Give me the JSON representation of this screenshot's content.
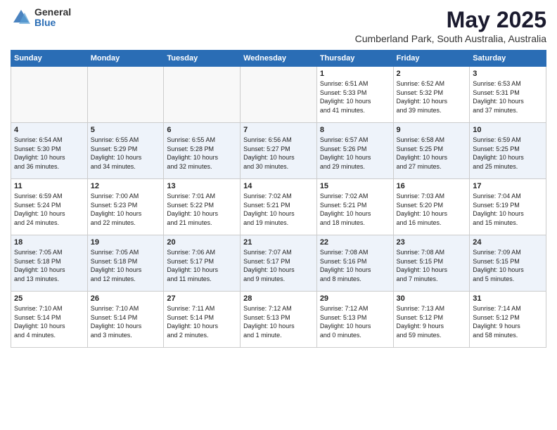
{
  "header": {
    "logo_general": "General",
    "logo_blue": "Blue",
    "title": "May 2025",
    "location": "Cumberland Park, South Australia, Australia"
  },
  "weekdays": [
    "Sunday",
    "Monday",
    "Tuesday",
    "Wednesday",
    "Thursday",
    "Friday",
    "Saturday"
  ],
  "weeks": [
    [
      {
        "day": "",
        "info": ""
      },
      {
        "day": "",
        "info": ""
      },
      {
        "day": "",
        "info": ""
      },
      {
        "day": "",
        "info": ""
      },
      {
        "day": "1",
        "info": "Sunrise: 6:51 AM\nSunset: 5:33 PM\nDaylight: 10 hours\nand 41 minutes."
      },
      {
        "day": "2",
        "info": "Sunrise: 6:52 AM\nSunset: 5:32 PM\nDaylight: 10 hours\nand 39 minutes."
      },
      {
        "day": "3",
        "info": "Sunrise: 6:53 AM\nSunset: 5:31 PM\nDaylight: 10 hours\nand 37 minutes."
      }
    ],
    [
      {
        "day": "4",
        "info": "Sunrise: 6:54 AM\nSunset: 5:30 PM\nDaylight: 10 hours\nand 36 minutes."
      },
      {
        "day": "5",
        "info": "Sunrise: 6:55 AM\nSunset: 5:29 PM\nDaylight: 10 hours\nand 34 minutes."
      },
      {
        "day": "6",
        "info": "Sunrise: 6:55 AM\nSunset: 5:28 PM\nDaylight: 10 hours\nand 32 minutes."
      },
      {
        "day": "7",
        "info": "Sunrise: 6:56 AM\nSunset: 5:27 PM\nDaylight: 10 hours\nand 30 minutes."
      },
      {
        "day": "8",
        "info": "Sunrise: 6:57 AM\nSunset: 5:26 PM\nDaylight: 10 hours\nand 29 minutes."
      },
      {
        "day": "9",
        "info": "Sunrise: 6:58 AM\nSunset: 5:25 PM\nDaylight: 10 hours\nand 27 minutes."
      },
      {
        "day": "10",
        "info": "Sunrise: 6:59 AM\nSunset: 5:25 PM\nDaylight: 10 hours\nand 25 minutes."
      }
    ],
    [
      {
        "day": "11",
        "info": "Sunrise: 6:59 AM\nSunset: 5:24 PM\nDaylight: 10 hours\nand 24 minutes."
      },
      {
        "day": "12",
        "info": "Sunrise: 7:00 AM\nSunset: 5:23 PM\nDaylight: 10 hours\nand 22 minutes."
      },
      {
        "day": "13",
        "info": "Sunrise: 7:01 AM\nSunset: 5:22 PM\nDaylight: 10 hours\nand 21 minutes."
      },
      {
        "day": "14",
        "info": "Sunrise: 7:02 AM\nSunset: 5:21 PM\nDaylight: 10 hours\nand 19 minutes."
      },
      {
        "day": "15",
        "info": "Sunrise: 7:02 AM\nSunset: 5:21 PM\nDaylight: 10 hours\nand 18 minutes."
      },
      {
        "day": "16",
        "info": "Sunrise: 7:03 AM\nSunset: 5:20 PM\nDaylight: 10 hours\nand 16 minutes."
      },
      {
        "day": "17",
        "info": "Sunrise: 7:04 AM\nSunset: 5:19 PM\nDaylight: 10 hours\nand 15 minutes."
      }
    ],
    [
      {
        "day": "18",
        "info": "Sunrise: 7:05 AM\nSunset: 5:18 PM\nDaylight: 10 hours\nand 13 minutes."
      },
      {
        "day": "19",
        "info": "Sunrise: 7:05 AM\nSunset: 5:18 PM\nDaylight: 10 hours\nand 12 minutes."
      },
      {
        "day": "20",
        "info": "Sunrise: 7:06 AM\nSunset: 5:17 PM\nDaylight: 10 hours\nand 11 minutes."
      },
      {
        "day": "21",
        "info": "Sunrise: 7:07 AM\nSunset: 5:17 PM\nDaylight: 10 hours\nand 9 minutes."
      },
      {
        "day": "22",
        "info": "Sunrise: 7:08 AM\nSunset: 5:16 PM\nDaylight: 10 hours\nand 8 minutes."
      },
      {
        "day": "23",
        "info": "Sunrise: 7:08 AM\nSunset: 5:15 PM\nDaylight: 10 hours\nand 7 minutes."
      },
      {
        "day": "24",
        "info": "Sunrise: 7:09 AM\nSunset: 5:15 PM\nDaylight: 10 hours\nand 5 minutes."
      }
    ],
    [
      {
        "day": "25",
        "info": "Sunrise: 7:10 AM\nSunset: 5:14 PM\nDaylight: 10 hours\nand 4 minutes."
      },
      {
        "day": "26",
        "info": "Sunrise: 7:10 AM\nSunset: 5:14 PM\nDaylight: 10 hours\nand 3 minutes."
      },
      {
        "day": "27",
        "info": "Sunrise: 7:11 AM\nSunset: 5:14 PM\nDaylight: 10 hours\nand 2 minutes."
      },
      {
        "day": "28",
        "info": "Sunrise: 7:12 AM\nSunset: 5:13 PM\nDaylight: 10 hours\nand 1 minute."
      },
      {
        "day": "29",
        "info": "Sunrise: 7:12 AM\nSunset: 5:13 PM\nDaylight: 10 hours\nand 0 minutes."
      },
      {
        "day": "30",
        "info": "Sunrise: 7:13 AM\nSunset: 5:12 PM\nDaylight: 9 hours\nand 59 minutes."
      },
      {
        "day": "31",
        "info": "Sunrise: 7:14 AM\nSunset: 5:12 PM\nDaylight: 9 hours\nand 58 minutes."
      }
    ]
  ]
}
